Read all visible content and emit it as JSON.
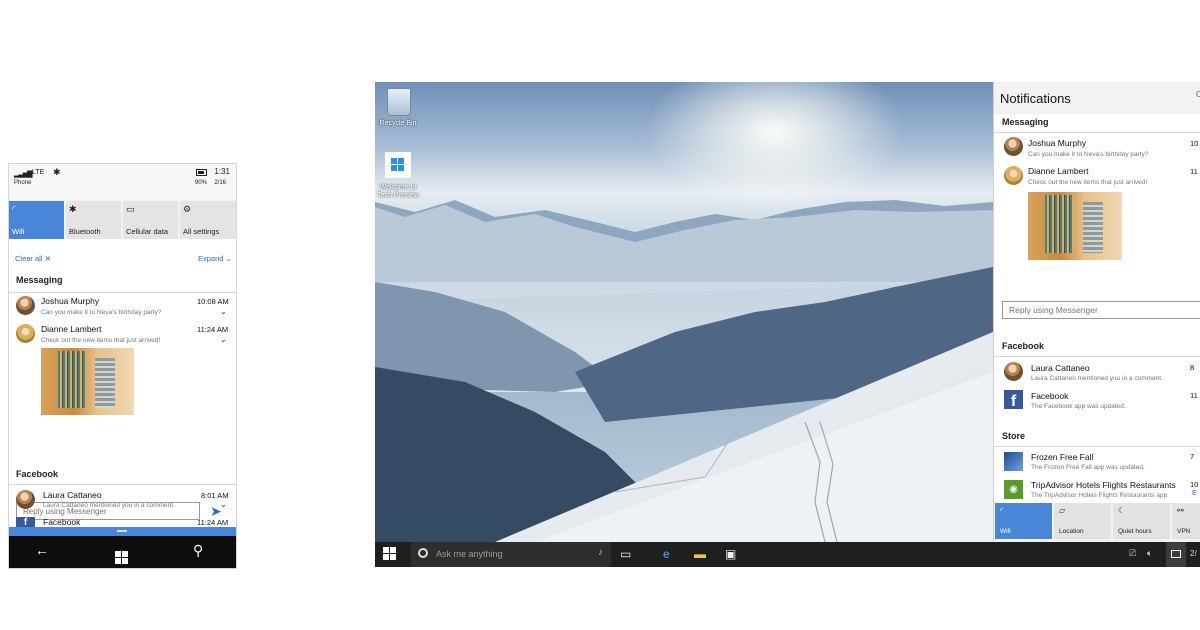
{
  "phone": {
    "status": {
      "carrier": "Phone",
      "network": "LTE",
      "time": "1:31",
      "battery": "90%",
      "date": "2/16"
    },
    "quick_actions": [
      {
        "label": "Wifi",
        "icon": "wifi-icon",
        "active": true
      },
      {
        "label": "Bluetooth",
        "icon": "bluetooth-icon",
        "active": false
      },
      {
        "label": "Cellular data",
        "icon": "cellular-data-icon",
        "active": false
      },
      {
        "label": "All settings",
        "icon": "gear-icon",
        "active": false
      }
    ],
    "clear_all": "Clear all",
    "expand": "Expand",
    "groups": {
      "messaging": {
        "title": "Messaging",
        "items": [
          {
            "name": "Joshua Murphy",
            "message": "Can you make it to Neva's birthday party?",
            "time": "10:08 AM"
          },
          {
            "name": "Dianne Lambert",
            "message": "Check out the new items that just arrived!",
            "time": "11:24 AM"
          }
        ]
      },
      "facebook": {
        "title": "Facebook",
        "items": [
          {
            "name": "Laura Cattaneo",
            "message": "Laura Cattaneo mentioned you in a comment.",
            "time": "8:01 AM"
          },
          {
            "name": "Facebook",
            "message": "",
            "time": "11:24 AM"
          }
        ]
      }
    },
    "reply_placeholder": "Reply using Messenger"
  },
  "desktop": {
    "icons": [
      {
        "label": "Recycle Bin"
      },
      {
        "label": "Welcome to Tech Preview"
      }
    ],
    "taskbar": {
      "search_placeholder": "Ask me anything",
      "date": "2/"
    },
    "action_center": {
      "title": "Notifications",
      "clear_all": "C",
      "groups": {
        "messaging": {
          "title": "Messaging",
          "items": [
            {
              "name": "Joshua Murphy",
              "message": "Can you make it to Neva's birthday party?",
              "time": "10"
            },
            {
              "name": "Dianne Lambert",
              "message": "Check out the new items that just arrived!",
              "time": "11"
            }
          ]
        },
        "facebook": {
          "title": "Facebook",
          "items": [
            {
              "name": "Laura Cattaneo",
              "message": "Laura Cattaneo mentioned you in a comment.",
              "time": "8"
            },
            {
              "name": "Facebook",
              "message": "The Facebook app was updated.",
              "time": "11"
            }
          ]
        },
        "store": {
          "title": "Store",
          "items": [
            {
              "name": "Frozen Free Fall",
              "message": "The Frozen Free Fall app was updated.",
              "time": "7"
            },
            {
              "name": "TripAdvisor Hotels Flights Restaurants",
              "message": "The TripAdvisor Hotels Flights Restaurants app",
              "time": "10"
            }
          ]
        }
      },
      "reply_placeholder": "Reply using Messenger",
      "expand": "E",
      "quick_actions": [
        {
          "label": "Wifi",
          "icon": "wifi-icon",
          "active": true
        },
        {
          "label": "Location",
          "icon": "location-icon",
          "active": false
        },
        {
          "label": "Quiet hours",
          "icon": "moon-icon",
          "active": false
        },
        {
          "label": "VPN",
          "icon": "vpn-icon",
          "active": false
        }
      ]
    }
  },
  "colors": {
    "accent": "#4a86d8",
    "link": "#2d6dc9",
    "taskbar": "#1f1f1f",
    "facebook": "#3b5998"
  }
}
